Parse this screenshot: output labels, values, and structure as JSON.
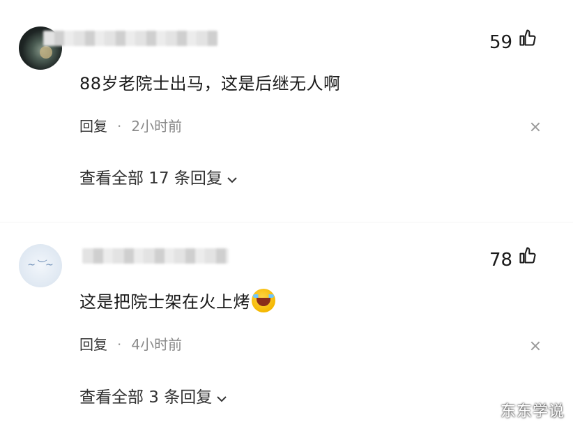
{
  "comments": [
    {
      "username_blurred": "",
      "likes": "59",
      "text": "88岁老院士出马，这是后继无人啊",
      "reply_label": "回复",
      "separator": "·",
      "time": "2小时前",
      "view_replies": "查看全部 17 条回复"
    },
    {
      "username_blurred": "",
      "likes": "78",
      "text": "这是把院士架在火上烤",
      "reply_label": "回复",
      "separator": "·",
      "time": "4小时前",
      "view_replies": "查看全部 3 条回复"
    }
  ],
  "icons": {
    "like": "thumbs-up-icon",
    "close": "close-icon",
    "chevron": "chevron-down-icon",
    "emoji": "laughing-crying-emoji"
  },
  "watermark": "东东学说"
}
